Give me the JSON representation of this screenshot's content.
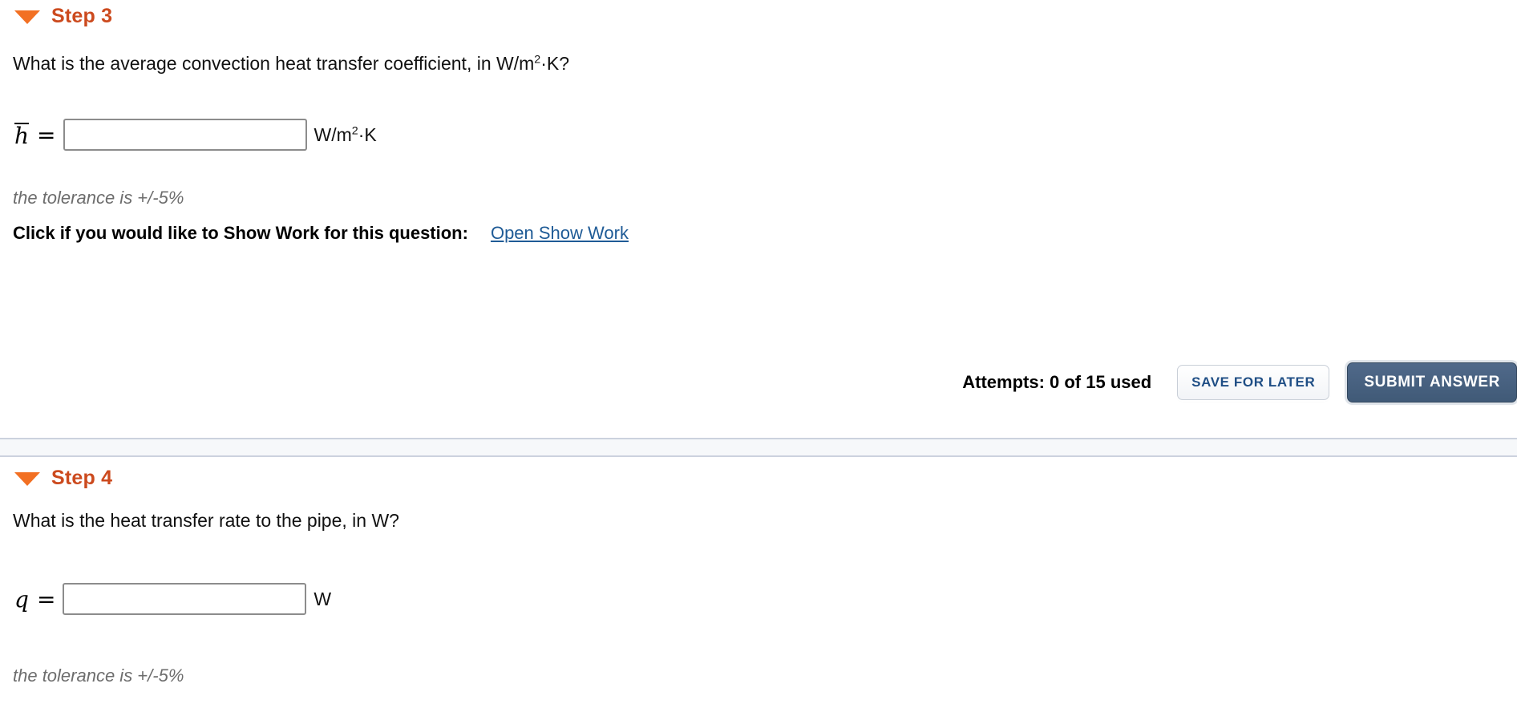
{
  "steps": [
    {
      "id": "step-3",
      "title": "Step 3",
      "collapse_icon": "triangle-down-icon",
      "question_prefix": "What is the average convection heat transfer coefficient, in W/m",
      "question_exponent": "2",
      "question_suffix": "·K?",
      "answer": {
        "variable": "h",
        "variable_has_overline": true,
        "equals": "=",
        "value": "",
        "placeholder": "",
        "unit_prefix": "W/m",
        "unit_exponent": "2",
        "unit_suffix": "·K"
      },
      "tolerance": "the tolerance is +/-5%",
      "show_work": {
        "label": "Click if you would like to Show Work for this question:",
        "link": "Open Show Work"
      },
      "actions": {
        "attempts": "Attempts: 0 of 15 used",
        "save_label": "SAVE FOR LATER",
        "submit_label": "SUBMIT ANSWER"
      }
    },
    {
      "id": "step-4",
      "title": "Step 4",
      "collapse_icon": "triangle-down-icon",
      "question_prefix": "What is the heat transfer rate to the pipe, in W?",
      "question_exponent": "",
      "question_suffix": "",
      "answer": {
        "variable": "q",
        "variable_has_overline": false,
        "equals": "=",
        "value": "",
        "placeholder": "",
        "unit_prefix": "W",
        "unit_exponent": "",
        "unit_suffix": ""
      },
      "tolerance": "the tolerance is +/-5%"
    }
  ],
  "colors": {
    "step_title": "#cc4a1e",
    "triangle": "#e8722c",
    "link": "#1f5b96",
    "submit_bg": "#44607d",
    "save_text": "#1f4e85",
    "tolerance_text": "#6d6d6d",
    "divider_fill": "#f6f8fa",
    "divider_border": "#ccd2de"
  }
}
